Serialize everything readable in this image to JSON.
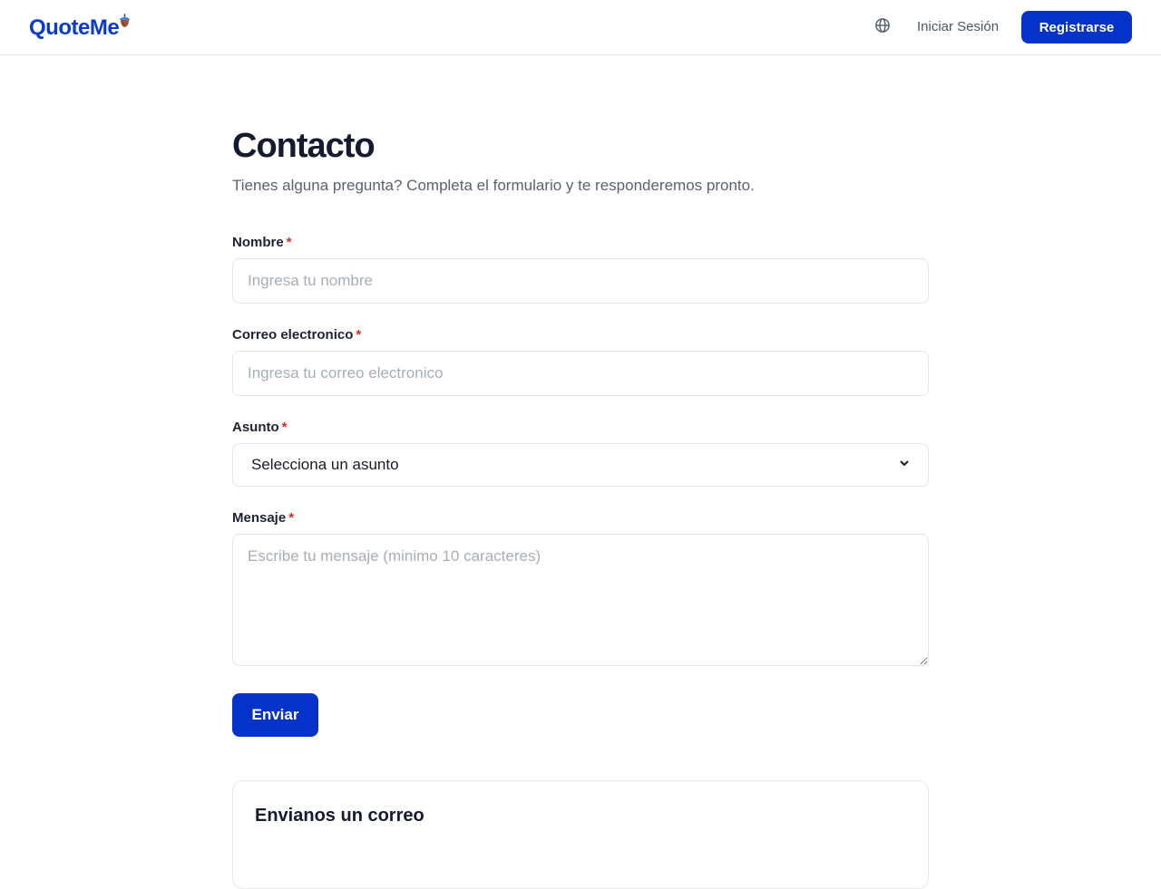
{
  "header": {
    "logo_text": "QuoteMe",
    "language_icon": "globe-icon",
    "signin_label": "Iniciar Sesión",
    "register_label": "Registrarse"
  },
  "page": {
    "title": "Contacto",
    "subtitle": "Tienes alguna pregunta? Completa el formulario y te responderemos pronto."
  },
  "form": {
    "required_mark": "*",
    "name": {
      "label": "Nombre",
      "placeholder": "Ingresa tu nombre",
      "value": ""
    },
    "email": {
      "label": "Correo electronico",
      "placeholder": "Ingresa tu correo electronico",
      "value": ""
    },
    "subject": {
      "label": "Asunto",
      "selected": "Selecciona un asunto"
    },
    "message": {
      "label": "Mensaje",
      "placeholder": "Escribe tu mensaje (minimo 10 caracteres)",
      "value": ""
    },
    "submit_label": "Enviar"
  },
  "email_card": {
    "title": "Envianos un correo"
  },
  "colors": {
    "brand": "#0533c9",
    "required": "#e0281f",
    "border": "#e1e4ea",
    "text_muted": "#5b6172"
  }
}
